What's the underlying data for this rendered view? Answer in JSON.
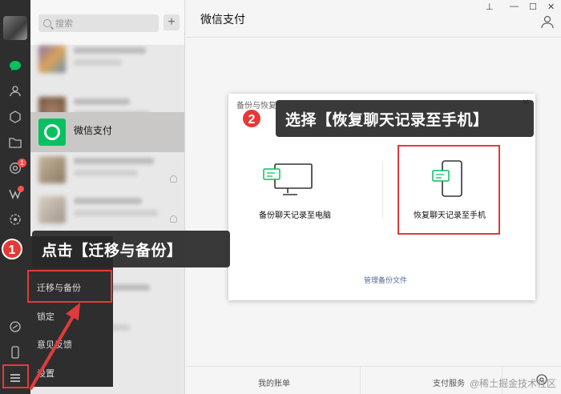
{
  "app": {
    "search_placeholder": "搜索",
    "add_symbol": "+",
    "main_title": "微信支付"
  },
  "rail": {
    "icons": [
      "avatar",
      "chat-icon",
      "contacts-icon",
      "collection-icon",
      "folder-icon",
      "moments-icon",
      "channels-icon",
      "miniprogram-icon",
      "link-icon",
      "phone-icon",
      "menu-icon"
    ],
    "moments_badge": "1"
  },
  "session_list": {
    "active_item": "微信支付"
  },
  "dialog": {
    "title": "备份与恢复",
    "close": "×",
    "option_pc": "备份聊天记录至电脑",
    "option_phone": "恢复聊天记录至手机",
    "manage_link": "管理备份文件"
  },
  "menu": {
    "items": [
      "迁移与备份",
      "锁定",
      "意见反馈",
      "设置"
    ]
  },
  "footer": {
    "my_bill": "我的账单",
    "pay_service": "支付服务"
  },
  "callouts": {
    "step1_num": "1",
    "step1_text": "点击【迁移与备份】",
    "step2_num": "2",
    "step2_text": "选择【恢复聊天记录至手机】"
  },
  "watermark": "@稀土掘金技术社区",
  "colors": {
    "rail_bg": "#2e2e2e",
    "wechat_green": "#07c160",
    "highlight_red": "#e03b3b",
    "badge_red": "#e53935"
  }
}
